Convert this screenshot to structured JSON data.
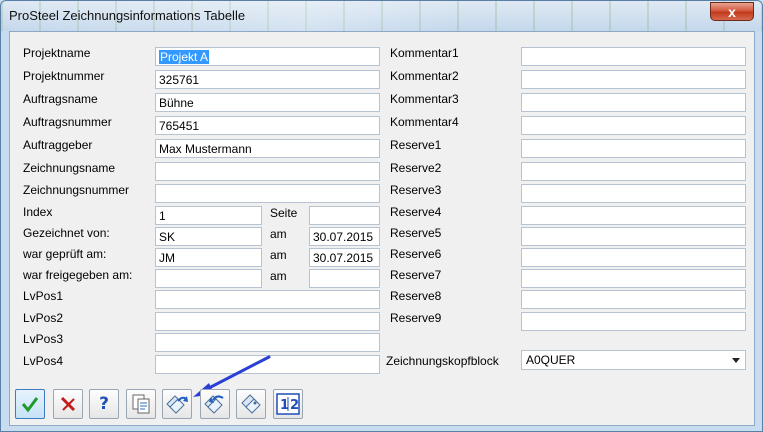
{
  "window": {
    "title": "ProSteel Zeichnungsinformations Tabelle",
    "close_label": "x"
  },
  "left": {
    "labels": {
      "projektname": "Projektname",
      "projektnummer": "Projektnummer",
      "auftragsname": "Auftragsname",
      "auftragsnummer": "Auftragsnummer",
      "auftraggeber": "Auftraggeber",
      "zeichnungsname": "Zeichnungsname",
      "zeichnungsnummer": "Zeichnungsnummer",
      "index": "Index",
      "gezeichnet": "Gezeichnet von:",
      "geprueft": "war geprüft am:",
      "freigegeben": "war freigegeben am:",
      "lvpos1": "LvPos1",
      "lvpos2": "LvPos2",
      "lvpos3": "LvPos3",
      "lvpos4": "LvPos4",
      "seite": "Seite",
      "am": "am"
    },
    "values": {
      "projektname": "Projekt A",
      "projektnummer": "325761",
      "auftragsname": "Bühne",
      "auftragsnummer": "765451",
      "auftraggeber": "Max Mustermann",
      "zeichnungsname": "",
      "zeichnungsnummer": "",
      "index": "1",
      "seite": "",
      "gezeichnet_von": "SK",
      "gezeichnet_am": "30.07.2015",
      "geprueft_von": "JM",
      "geprueft_am": "30.07.2015",
      "freigegeben_von": "",
      "freigegeben_am": "",
      "lvpos1": "",
      "lvpos2": "",
      "lvpos3": "",
      "lvpos4": ""
    }
  },
  "right": {
    "labels": {
      "kommentar1": "Kommentar1",
      "kommentar2": "Kommentar2",
      "kommentar3": "Kommentar3",
      "kommentar4": "Kommentar4",
      "reserve1": "Reserve1",
      "reserve2": "Reserve2",
      "reserve3": "Reserve3",
      "reserve4": "Reserve4",
      "reserve5": "Reserve5",
      "reserve6": "Reserve6",
      "reserve7": "Reserve7",
      "reserve8": "Reserve8",
      "reserve9": "Reserve9",
      "zeichnungskopfblock": "Zeichnungskopfblock"
    },
    "values": {
      "zeichnungskopfblock": "A0QUER"
    }
  },
  "toolbar": {
    "buttons": [
      {
        "name": "ok",
        "icon": "check-icon"
      },
      {
        "name": "cancel",
        "icon": "x-mark-icon"
      },
      {
        "name": "help",
        "icon": "question-icon"
      },
      {
        "name": "copy",
        "icon": "copy-document-icon"
      },
      {
        "name": "export",
        "icon": "tag-export-icon"
      },
      {
        "name": "import",
        "icon": "tag-import-icon"
      },
      {
        "name": "tags",
        "icon": "tags-icon"
      },
      {
        "name": "numbering",
        "icon": "numbering-12-icon"
      }
    ],
    "help_label": "?",
    "numbering_label_1": "1",
    "numbering_label_2": "2"
  },
  "colors": {
    "accent_arrow": "#2a3fd6",
    "check_green": "#1e9a2e",
    "cancel_red": "#c41a1a",
    "help_blue": "#1f4fb5"
  }
}
